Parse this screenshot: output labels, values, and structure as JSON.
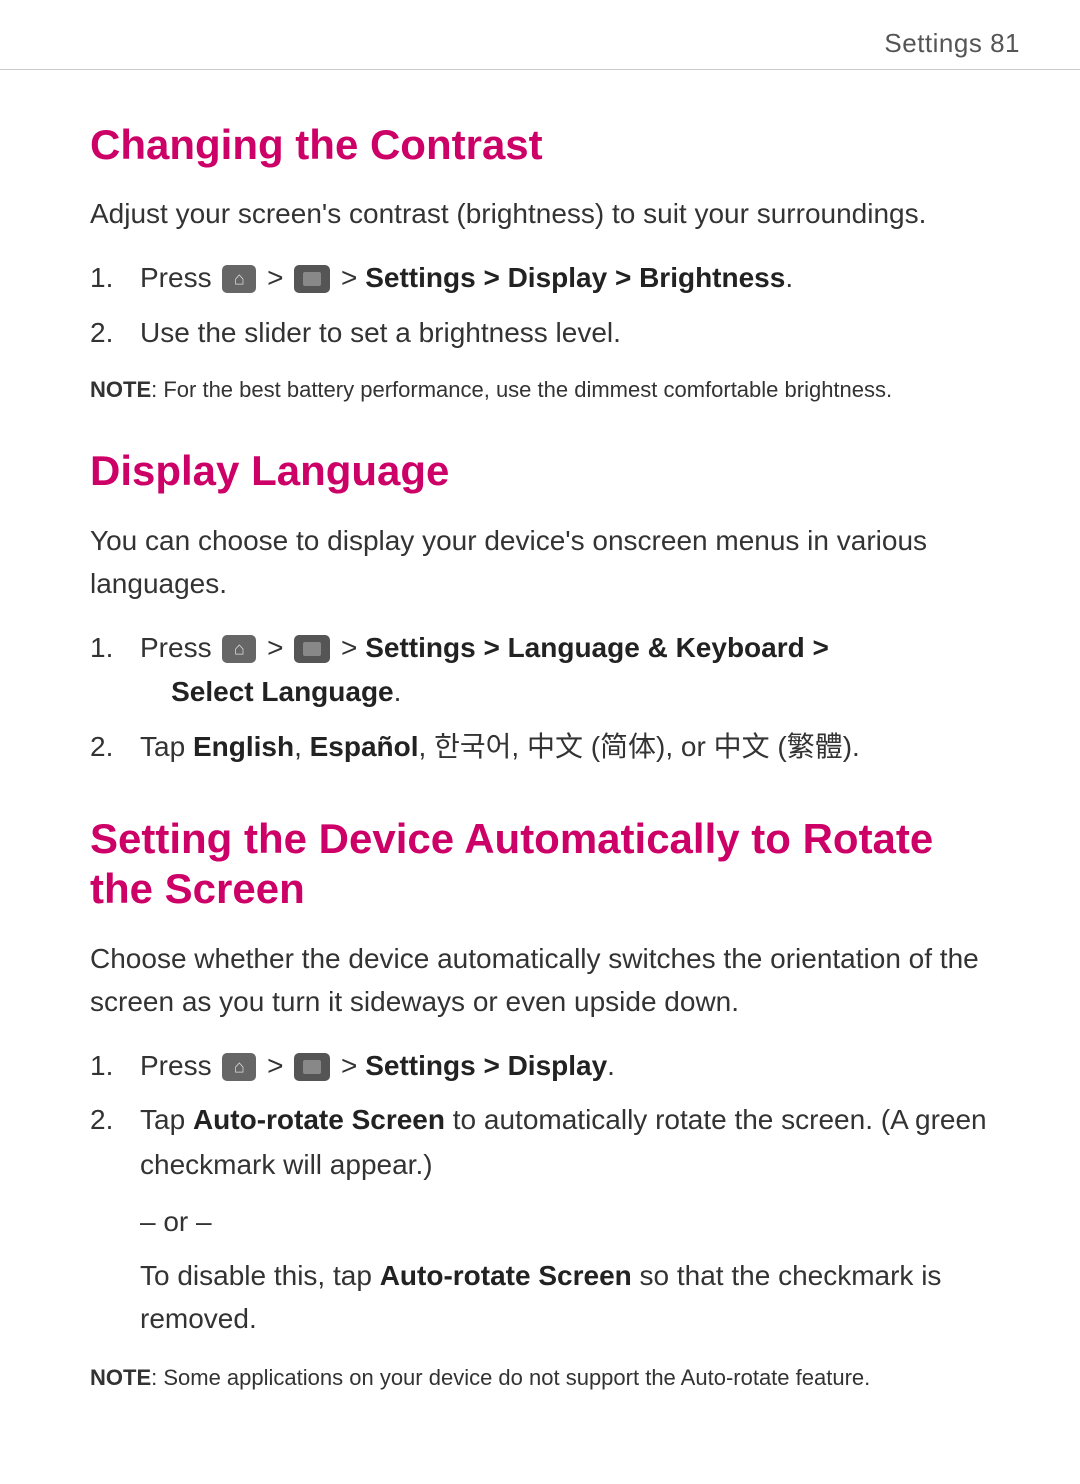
{
  "header": {
    "text": "Settings  81"
  },
  "sections": [
    {
      "id": "changing-contrast",
      "heading": "Changing the Contrast",
      "intro": "Adjust your screen's contrast (brightness) to suit your surroundings.",
      "steps": [
        {
          "number": "1.",
          "text_before": "Press ",
          "icons": [
            "home",
            "menu"
          ],
          "text_middle": " > ",
          "text_bold": "Settings > Display > Brightness",
          "text_after": "."
        },
        {
          "number": "2.",
          "text": "Use the slider to set a brightness level."
        }
      ],
      "note": "NOTE: For the best battery performance, use the dimmest comfortable brightness."
    },
    {
      "id": "display-language",
      "heading": "Display Language",
      "intro": "You can choose to display your device’s onscreen menus in various languages.",
      "steps": [
        {
          "number": "1.",
          "text_before": "Press ",
          "icons": [
            "home",
            "menu"
          ],
          "text_bold_parts": " > Settings > Language & Keyboard > Select Language",
          "text_after": "."
        },
        {
          "number": "2.",
          "text_tap": "Tap ",
          "text_bold": "English",
          "text_after": ", Español, 한국어, 中文 (简体), or 中文 (繁體)."
        }
      ]
    },
    {
      "id": "auto-rotate",
      "heading": "Setting the Device Automatically to Rotate the Screen",
      "intro": "Choose whether the device automatically switches the orientation of the screen as you turn it sideways or even upside down.",
      "steps": [
        {
          "number": "1.",
          "text_before": "Press ",
          "icons": [
            "home",
            "menu"
          ],
          "text_bold": " > Settings > Display",
          "text_after": "."
        },
        {
          "number": "2.",
          "text_tap": "Tap ",
          "text_bold": "Auto-rotate Screen",
          "text_after": " to automatically rotate the screen. (A green checkmark will appear.)"
        }
      ],
      "or_text": "– or –",
      "or_content_bold": "Auto-rotate Screen",
      "or_content": "To disable this, tap Auto-rotate Screen so that the checkmark is removed.",
      "note": "NOTE: Some applications on your device do not support the Auto-rotate feature."
    }
  ]
}
